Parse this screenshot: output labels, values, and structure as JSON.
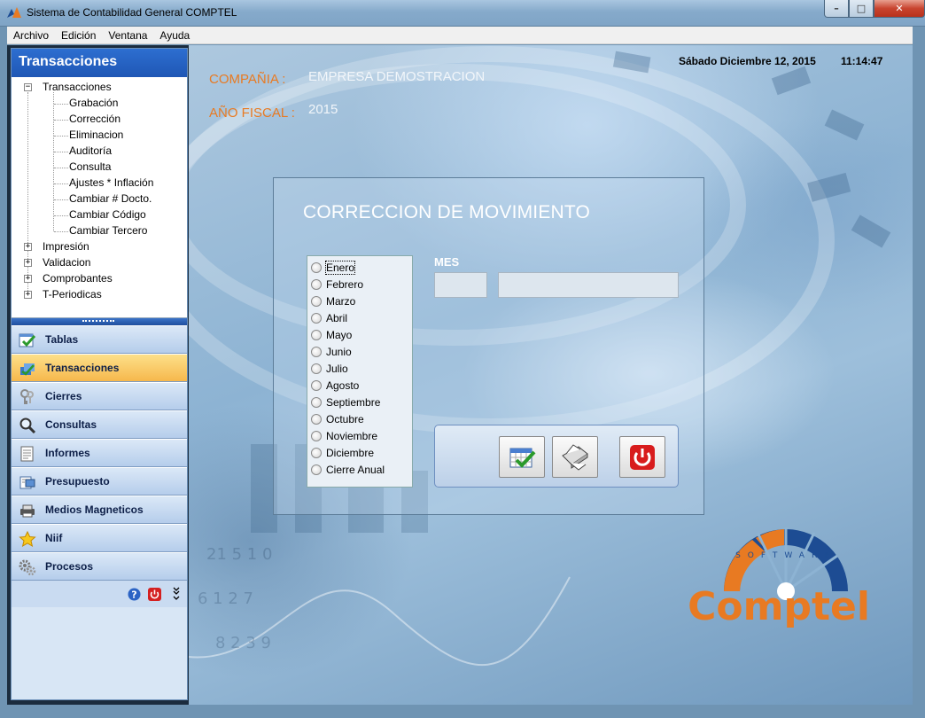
{
  "window": {
    "title": "Sistema de Contabilidad General COMPTEL",
    "min": "–",
    "max": "□",
    "close": "✕"
  },
  "menu": [
    "Archivo",
    "Edición",
    "Ventana",
    "Ayuda"
  ],
  "sidebar": {
    "header": "Transacciones",
    "tree": {
      "root": "Transacciones",
      "children": [
        "Grabación",
        "Corrección",
        "Eliminacion",
        "Auditoría",
        "Consulta",
        "Ajustes * Inflación",
        "Cambiar # Docto.",
        "Cambiar Código",
        "Cambiar Tercero"
      ],
      "collapsed": [
        "Impresión",
        "Validacion",
        "Comprobantes",
        "T-Periodicas"
      ]
    },
    "nav": [
      {
        "label": "Tablas",
        "icon": "table-check-icon"
      },
      {
        "label": "Transacciones",
        "icon": "transactions-icon",
        "active": true
      },
      {
        "label": "Cierres",
        "icon": "keys-icon"
      },
      {
        "label": "Consultas",
        "icon": "magnifier-icon"
      },
      {
        "label": "Informes",
        "icon": "document-icon"
      },
      {
        "label": "Presupuesto",
        "icon": "budget-icon"
      },
      {
        "label": "Medios Magneticos",
        "icon": "printer-icon"
      },
      {
        "label": "Niif",
        "icon": "star-icon"
      },
      {
        "label": "Procesos",
        "icon": "gears-icon"
      }
    ]
  },
  "header": {
    "company_label": "COMPAÑIA :",
    "company_value": "EMPRESA DEMOSTRACION",
    "year_label": "AÑO FISCAL :",
    "year_value": "2015",
    "date": "Sábado Diciembre 12, 2015",
    "time": "11:14:47"
  },
  "dialog": {
    "title": "CORRECCION DE MOVIMIENTO",
    "months": [
      "Enero",
      "Febrero",
      "Marzo",
      "Abril",
      "Mayo",
      "Junio",
      "Julio",
      "Agosto",
      "Septiembre",
      "Octubre",
      "Noviembre",
      "Diciembre",
      "Cierre Anual"
    ],
    "selected_month": "Enero",
    "mes_label": "MES",
    "mes_number": "",
    "mes_name": ""
  },
  "logo": {
    "top_text": "SOFTWARE",
    "brand": "Comptel"
  },
  "colors": {
    "accent_orange": "#e87a22",
    "nav_active": "#f6b84c",
    "brand_blue": "#1d4c93"
  }
}
